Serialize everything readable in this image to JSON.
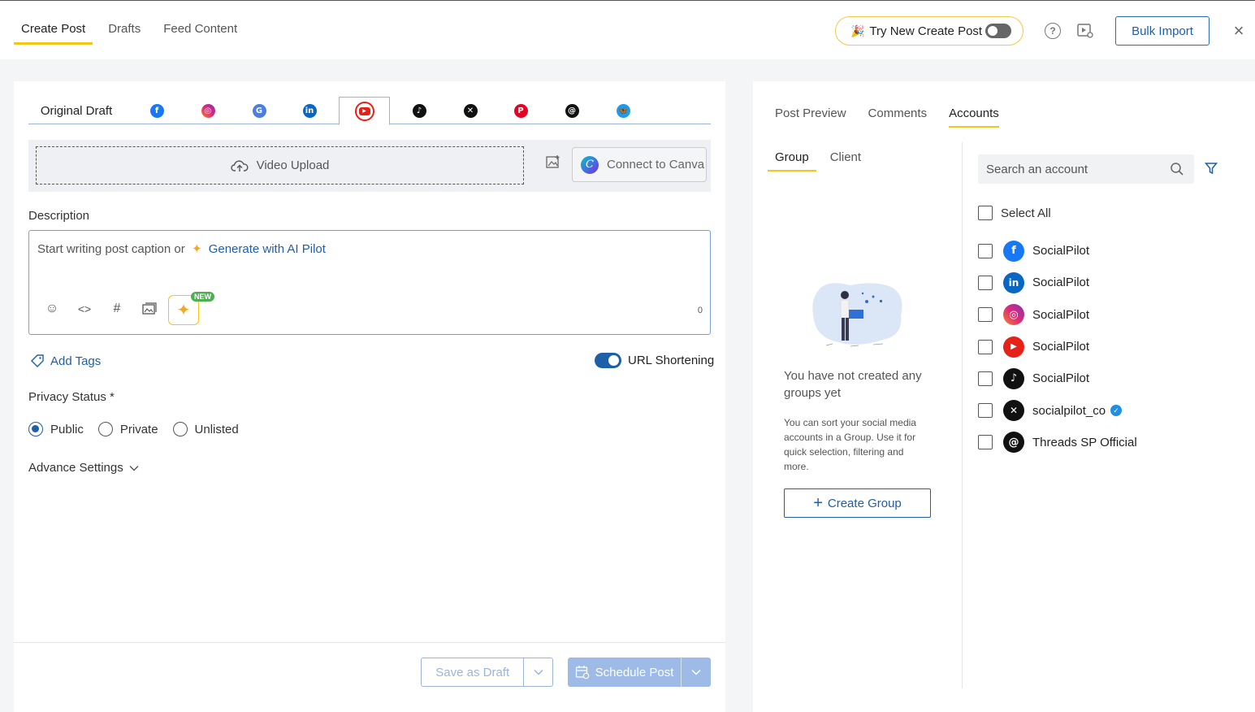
{
  "top_tabs": [
    "Create Post",
    "Drafts",
    "Feed Content"
  ],
  "try_new": {
    "label": "Try New Create Post",
    "enabled": false
  },
  "bulk_import": "Bulk Import",
  "network_tabs": {
    "original": "Original Draft",
    "icons": [
      "facebook-icon",
      "instagram-icon",
      "google-business-icon",
      "linkedin-icon",
      "youtube-icon",
      "tiktok-icon",
      "x-icon",
      "pinterest-icon",
      "threads-icon",
      "bluesky-icon"
    ],
    "active": "youtube-icon"
  },
  "upload": {
    "label": "Video Upload",
    "canva": "Connect to Canva"
  },
  "description": {
    "label": "Description",
    "placeholder": "Start writing post caption or",
    "ai_link": "Generate with AI Pilot",
    "new_badge": "NEW",
    "char_count": "0"
  },
  "add_tags": "Add Tags",
  "url_shortening": {
    "label": "URL Shortening",
    "enabled": true
  },
  "privacy": {
    "label": "Privacy Status *",
    "options": [
      "Public",
      "Private",
      "Unlisted"
    ],
    "selected": "Public"
  },
  "advance_settings": "Advance Settings",
  "footer": {
    "save_draft": "Save as Draft",
    "schedule": "Schedule Post"
  },
  "right": {
    "tabs": [
      "Post Preview",
      "Comments",
      "Accounts"
    ],
    "active_tab": "Accounts",
    "sub_tabs": [
      "Group",
      "Client"
    ],
    "empty_title": "You have not created any groups yet",
    "empty_desc": "You can sort your social media accounts in a Group. Use it for quick selection, filtering and more.",
    "create_group": "Create Group",
    "search_placeholder": "Search an account",
    "select_all": "Select All",
    "accounts": [
      {
        "name": "SocialPilot",
        "network": "facebook"
      },
      {
        "name": "SocialPilot",
        "network": "linkedin"
      },
      {
        "name": "SocialPilot",
        "network": "instagram"
      },
      {
        "name": "SocialPilot",
        "network": "youtube"
      },
      {
        "name": "SocialPilot",
        "network": "tiktok"
      },
      {
        "name": "socialpilot_co",
        "network": "x",
        "verified": true
      },
      {
        "name": "Threads SP Official",
        "network": "threads"
      }
    ]
  },
  "colors": {
    "accent": "#f5c518",
    "primary": "#1f5ea8"
  }
}
